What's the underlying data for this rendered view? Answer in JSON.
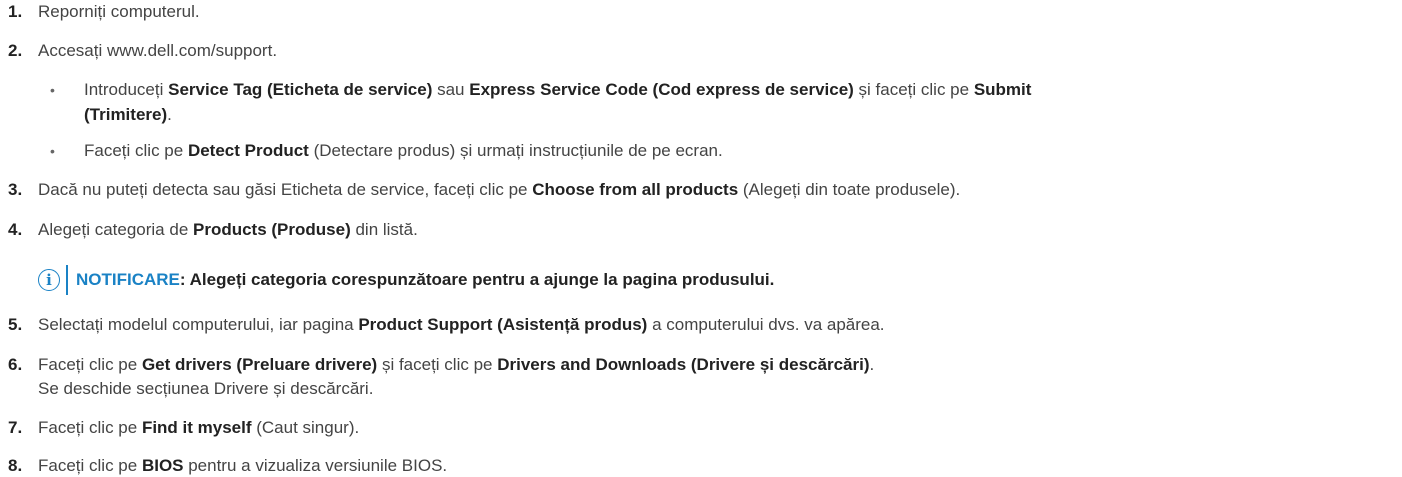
{
  "steps": [
    {
      "num": "1.",
      "parts": [
        {
          "t": "Reporniți computerul.",
          "b": false
        }
      ]
    },
    {
      "num": "2.",
      "parts": [
        {
          "t": "Accesați www.dell.com/support.",
          "b": false
        }
      ]
    },
    {
      "num": "3.",
      "parts": [
        {
          "t": "Dacă nu puteți detecta sau găsi Eticheta de service, faceți clic pe ",
          "b": false
        },
        {
          "t": "Choose from all products",
          "b": true
        },
        {
          "t": " (Alegeți din toate produsele).",
          "b": false
        }
      ]
    },
    {
      "num": "4.",
      "parts": [
        {
          "t": "Alegeți categoria de ",
          "b": false
        },
        {
          "t": "Products (Produse)",
          "b": true
        },
        {
          "t": " din listă.",
          "b": false
        }
      ]
    },
    {
      "num": "5.",
      "parts": [
        {
          "t": "Selectați modelul computerului, iar pagina ",
          "b": false
        },
        {
          "t": "Product Support (Asistență produs)",
          "b": true
        },
        {
          "t": " a computerului dvs. va apărea.",
          "b": false
        }
      ]
    },
    {
      "num": "6.",
      "parts": [
        {
          "t": "Faceți clic pe ",
          "b": false
        },
        {
          "t": "Get drivers (Preluare drivere)",
          "b": true
        },
        {
          "t": " și faceți clic pe ",
          "b": false
        },
        {
          "t": "Drivers and Downloads (Drivere și descărcări)",
          "b": true
        },
        {
          "t": ".",
          "b": false
        }
      ]
    },
    {
      "num": "7.",
      "parts": [
        {
          "t": "Faceți clic pe ",
          "b": false
        },
        {
          "t": "Find it myself",
          "b": true
        },
        {
          "t": " (Caut singur).",
          "b": false
        }
      ]
    },
    {
      "num": "8.",
      "parts": [
        {
          "t": "Faceți clic pe ",
          "b": false
        },
        {
          "t": "BIOS",
          "b": true
        },
        {
          "t": " pentru a vizualiza versiunile BIOS.",
          "b": false
        }
      ]
    }
  ],
  "step6_continuation": "Se deschide secțiunea Drivere și descărcări.",
  "substeps": [
    {
      "line1": [
        {
          "t": "Introduceți ",
          "b": false
        },
        {
          "t": "Service Tag (Eticheta de service)",
          "b": true
        },
        {
          "t": " sau ",
          "b": false
        },
        {
          "t": "Express Service Code (Cod express de service)",
          "b": true
        },
        {
          "t": " și faceți clic pe ",
          "b": false
        },
        {
          "t": "Submit",
          "b": true
        }
      ],
      "line2": [
        {
          "t": "(Trimitere)",
          "b": true
        },
        {
          "t": ".",
          "b": false
        }
      ]
    },
    {
      "line1": [
        {
          "t": "Faceți clic pe ",
          "b": false
        },
        {
          "t": "Detect Product",
          "b": true
        },
        {
          "t": " (Detectare produs) și urmați instrucțiunile de pe ecran.",
          "b": false
        }
      ]
    }
  ],
  "bullet_glyph": "•",
  "note": {
    "icon": "info-icon",
    "icon_glyph": "i",
    "label": "NOTIFICARE",
    "text": ": Alegeți categoria corespunzătoare pentru a ajunge la pagina produsului."
  },
  "colors": {
    "accent": "#1a82c5",
    "text": "#444444",
    "bold": "#222222"
  }
}
